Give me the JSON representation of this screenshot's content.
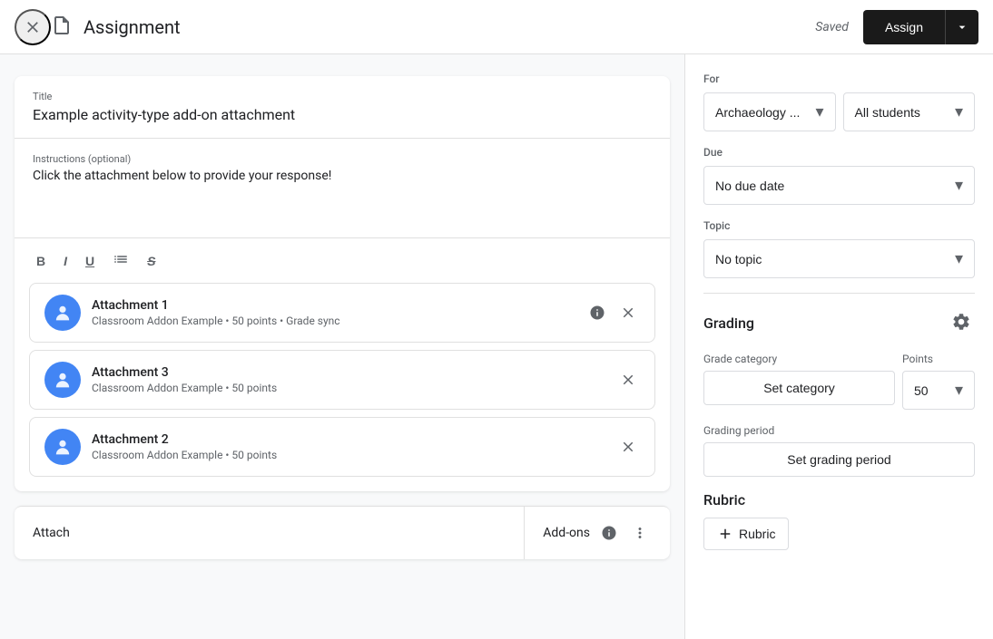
{
  "header": {
    "title": "Assignment",
    "saved_label": "Saved",
    "assign_label": "Assign",
    "close_icon": "×",
    "doc_icon": "📄"
  },
  "form": {
    "title_label": "Title",
    "title_value": "Example activity-type add-on attachment",
    "instructions_label": "Instructions (optional)",
    "instructions_value": "Click the attachment below to provide your response!",
    "toolbar": {
      "bold": "B",
      "italic": "I",
      "underline": "U",
      "list": "≡",
      "strikethrough": "S̶"
    }
  },
  "attachments": [
    {
      "name": "Attachment 1",
      "meta": "Classroom Addon Example • 50 points • Grade sync"
    },
    {
      "name": "Attachment 3",
      "meta": "Classroom Addon Example • 50 points"
    },
    {
      "name": "Attachment 2",
      "meta": "Classroom Addon Example • 50 points"
    }
  ],
  "bottom_bar": {
    "attach_label": "Attach",
    "addons_label": "Add-ons"
  },
  "right_panel": {
    "for_label": "For",
    "class_value": "Archaeology ...",
    "students_value": "All students",
    "due_label": "Due",
    "due_value": "No due date",
    "topic_label": "Topic",
    "topic_value": "No topic",
    "grading_title": "Grading",
    "grade_category_label": "Grade category",
    "points_label": "Points",
    "set_category_label": "Set category",
    "points_value": "50",
    "grading_period_label": "Grading period",
    "set_grading_period_label": "Set grading period",
    "rubric_label": "Rubric",
    "add_rubric_label": "Rubric"
  }
}
